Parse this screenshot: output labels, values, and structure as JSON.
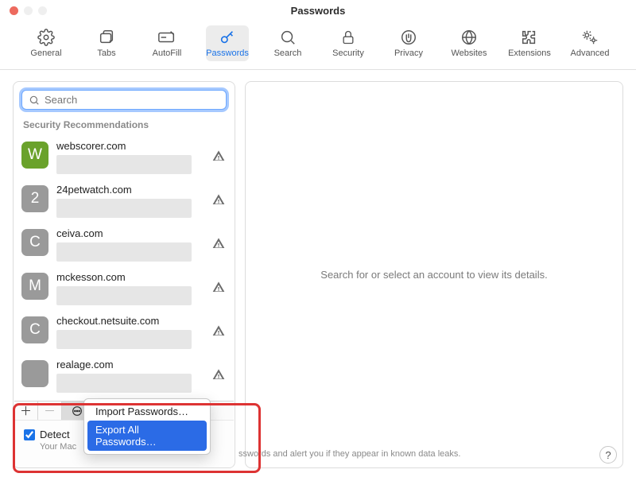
{
  "window": {
    "title": "Passwords"
  },
  "toolbar": {
    "general": "General",
    "tabs": "Tabs",
    "autofill": "AutoFill",
    "passwords": "Passwords",
    "search": "Search",
    "security": "Security",
    "privacy": "Privacy",
    "websites": "Websites",
    "extensions": "Extensions",
    "advanced": "Advanced"
  },
  "search": {
    "placeholder": "Search"
  },
  "sectionHeader": "Security Recommendations",
  "accounts": [
    {
      "letter": "W",
      "color": "#6aa22b",
      "site": "webscorer.com"
    },
    {
      "letter": "2",
      "color": "#9a9a9a",
      "site": "24petwatch.com"
    },
    {
      "letter": "C",
      "color": "#9a9a9a",
      "site": "ceiva.com"
    },
    {
      "letter": "M",
      "color": "#9a9a9a",
      "site": "mckesson.com"
    },
    {
      "letter": "C",
      "color": "#9a9a9a",
      "site": "checkout.netsuite.com"
    },
    {
      "letter": "",
      "color": "#9a9a9a",
      "site": "realage.com"
    }
  ],
  "detailPlaceholder": "Search for or select an account to view its details.",
  "moreMenu": {
    "import": "Import Passwords…",
    "export": "Export All Passwords…"
  },
  "detect": {
    "label": "Detect",
    "subtext": "Your Mac",
    "subtext2": "sswords and alert you if they appear in known data leaks."
  },
  "glyphs": {
    "plus": "＋",
    "minus": "－",
    "help": "?"
  }
}
